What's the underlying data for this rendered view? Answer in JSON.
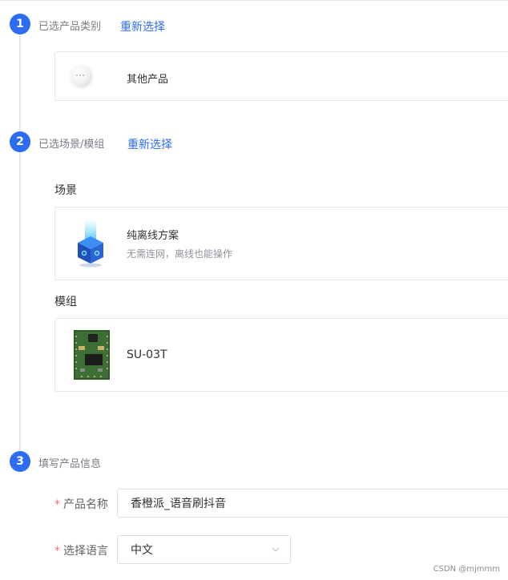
{
  "steps": [
    {
      "number": "1",
      "title": "已选产品类别",
      "action": "重新选择"
    },
    {
      "number": "2",
      "title": "已选场景/模组",
      "action": "重新选择"
    },
    {
      "number": "3",
      "title": "填写产品信息"
    }
  ],
  "category_card": {
    "title": "其他产品"
  },
  "scene": {
    "label": "场景",
    "title": "纯离线方案",
    "subtitle": "无需连网，离线也能操作"
  },
  "module": {
    "label": "模组",
    "title": "SU-03T"
  },
  "form": {
    "name_label": "产品名称",
    "name_value": "香橙派_语音刷抖音",
    "lang_label": "选择语言",
    "lang_value": "中文",
    "required_mark": "*"
  },
  "watermark": "CSDN @mjmmm",
  "colors": {
    "accent": "#2d6cf5",
    "required": "#f56c6c"
  }
}
